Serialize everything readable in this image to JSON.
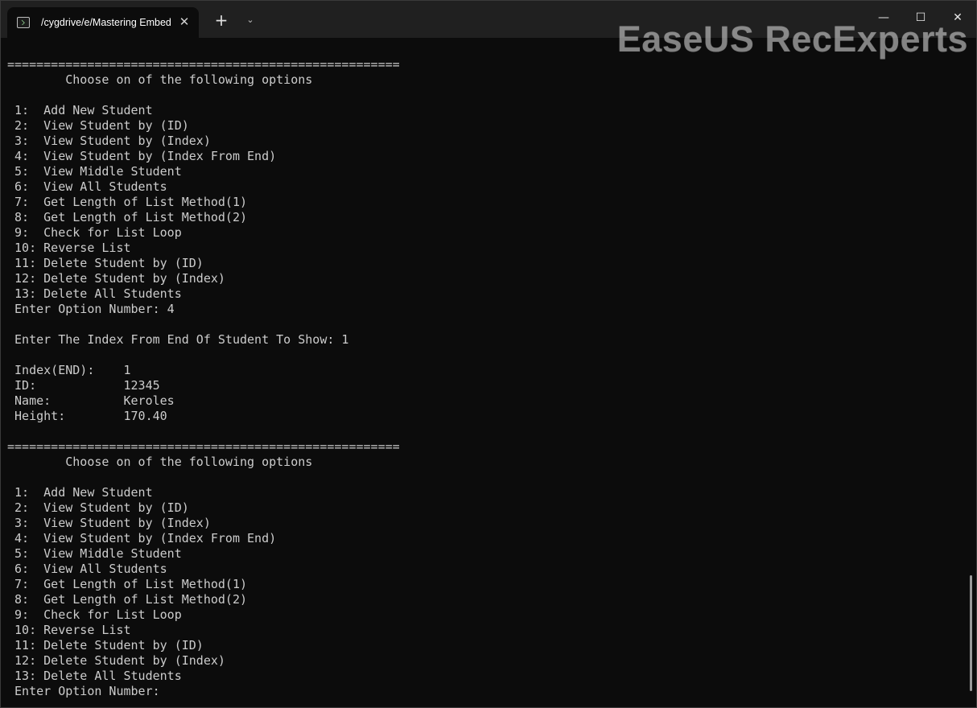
{
  "window": {
    "tab_title": "/cygdrive/e/Mastering Embed",
    "tab_close_glyph": "✕",
    "new_tab_glyph": "+",
    "dropdown_glyph": "⌄",
    "minimize_glyph": "—",
    "maximize_glyph": "☐",
    "close_glyph": "✕"
  },
  "watermark": "EaseUS RecExperts",
  "terminal": {
    "lines": [
      "======================================================",
      "        Choose on of the following options",
      "",
      " 1:  Add New Student",
      " 2:  View Student by (ID)",
      " 3:  View Student by (Index)",
      " 4:  View Student by (Index From End)",
      " 5:  View Middle Student",
      " 6:  View All Students",
      " 7:  Get Length of List Method(1)",
      " 8:  Get Length of List Method(2)",
      " 9:  Check for List Loop",
      " 10: Reverse List",
      " 11: Delete Student by (ID)",
      " 12: Delete Student by (Index)",
      " 13: Delete All Students",
      " Enter Option Number: 4",
      "",
      " Enter The Index From End Of Student To Show: 1",
      "",
      " Index(END):    1",
      " ID:            12345",
      " Name:          Keroles",
      " Height:        170.40",
      "",
      "======================================================",
      "        Choose on of the following options",
      "",
      " 1:  Add New Student",
      " 2:  View Student by (ID)",
      " 3:  View Student by (Index)",
      " 4:  View Student by (Index From End)",
      " 5:  View Middle Student",
      " 6:  View All Students",
      " 7:  Get Length of List Method(1)",
      " 8:  Get Length of List Method(2)",
      " 9:  Check for List Loop",
      " 10: Reverse List",
      " 11: Delete Student by (ID)",
      " 12: Delete Student by (Index)",
      " 13: Delete All Students",
      " Enter Option Number:"
    ]
  }
}
